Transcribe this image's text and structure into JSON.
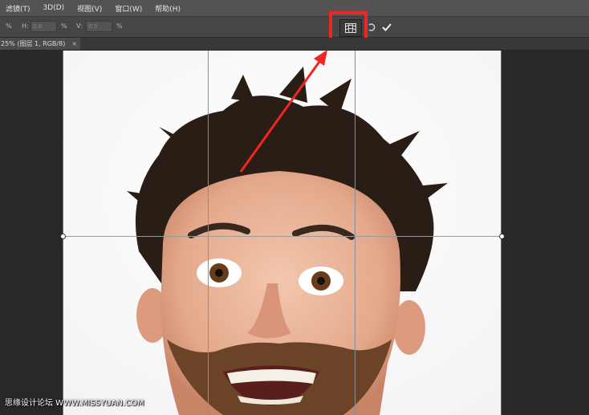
{
  "menu": {
    "items": [
      "滤镜(T)",
      "3D(D)",
      "视图(V)",
      "窗口(W)",
      "帮助(H)"
    ]
  },
  "options": {
    "pct_label": "%",
    "h_label": "H:",
    "h_value": "0.0",
    "h_unit": "%",
    "v_label": "V:",
    "v_value": "0.0",
    "v_unit": "%"
  },
  "document": {
    "tab_title": "25% (图层 1, RGB/8)",
    "tab_close": "×"
  },
  "watermark": {
    "text": "思缘设计论坛  WWW.MISSYUAN.COM"
  },
  "colors": {
    "highlight": "#f02525",
    "menubar": "#535353",
    "optionsbar": "#464646",
    "workspace": "#282828"
  },
  "icons": {
    "warp": "warp-icon",
    "cancel": "cancel-transform-icon",
    "commit": "checkmark-icon"
  }
}
